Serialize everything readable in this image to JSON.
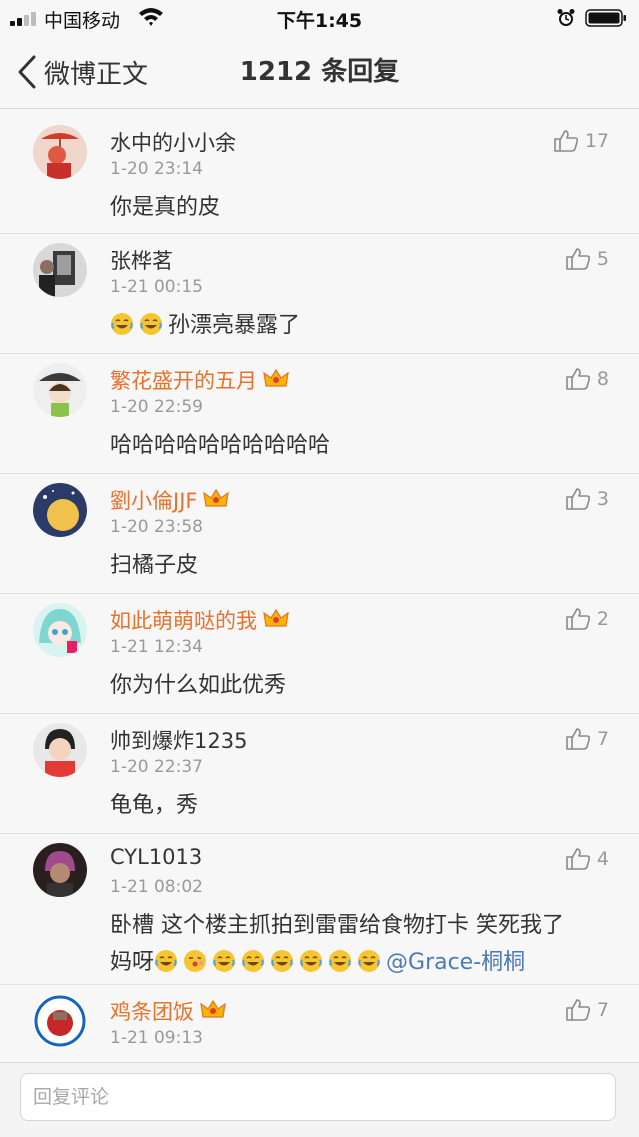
{
  "status_bar": {
    "carrier": "中国移动",
    "time": "下午1:45"
  },
  "nav": {
    "back_label": "微博正文",
    "title": "1212 条回复"
  },
  "comments": [
    {
      "name": "水中的小小余",
      "vip": false,
      "time": "1-20 23:14",
      "content": "你是真的皮",
      "likes": "17"
    },
    {
      "name": "张桦茗",
      "vip": false,
      "time": "1-21 00:15",
      "content": "孙漂亮暴露了",
      "likes": "5"
    },
    {
      "name": "繁花盛开的五月",
      "vip": true,
      "time": "1-20 22:59",
      "content": "哈哈哈哈哈哈哈哈哈哈",
      "likes": "8"
    },
    {
      "name": "劉小倫JJF",
      "vip": true,
      "time": "1-20 23:58",
      "content": "扫橘子皮",
      "likes": "3"
    },
    {
      "name": "如此萌萌哒的我",
      "vip": true,
      "time": "1-21 12:34",
      "content": "你为什么如此优秀",
      "likes": "2"
    },
    {
      "name": "帅到爆炸1235",
      "vip": false,
      "time": "1-20 22:37",
      "content": "龟龟，秀",
      "likes": "7"
    },
    {
      "name": "CYL1013",
      "vip": false,
      "time": "1-21 08:02",
      "content": "卧槽 这个楼主抓拍到雷雷给食物打卡 笑死我了",
      "content_line2": "妈呀",
      "mention": "@Grace-桐桐",
      "likes": "4"
    },
    {
      "name": "鸡条团饭",
      "vip": true,
      "time": "1-21 09:13",
      "content": "",
      "likes": "7"
    }
  ],
  "reply_bar": {
    "placeholder": "回复评论"
  }
}
